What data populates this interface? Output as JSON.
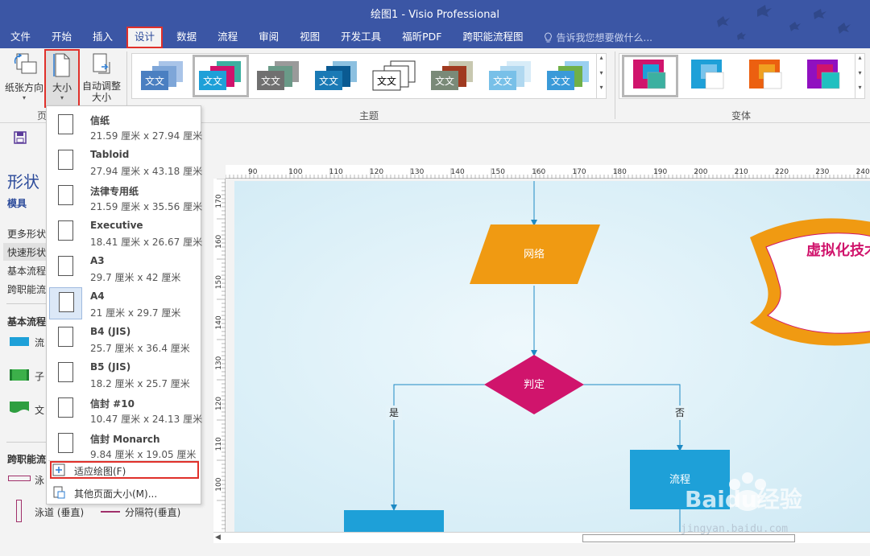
{
  "app": {
    "title": "绘图1 - Visio Professional"
  },
  "ribbon_tabs": [
    {
      "label": "文件",
      "active": false
    },
    {
      "label": "开始",
      "active": false
    },
    {
      "label": "插入",
      "active": false
    },
    {
      "label": "设计",
      "active": true
    },
    {
      "label": "数据",
      "active": false
    },
    {
      "label": "流程",
      "active": false
    },
    {
      "label": "审阅",
      "active": false
    },
    {
      "label": "视图",
      "active": false
    },
    {
      "label": "开发工具",
      "active": false
    },
    {
      "label": "福昕PDF",
      "active": false
    },
    {
      "label": "跨职能流程图",
      "active": false
    }
  ],
  "tell_me": {
    "placeholder": "告诉我您想要做什么..."
  },
  "page_setup": {
    "orientation_label": "纸张方向",
    "size_label": "大小",
    "autofit_label_1": "自动调整",
    "autofit_label_2": "大小",
    "group_label": "页"
  },
  "themes": {
    "group_label": "主题",
    "sample_text": "文文",
    "items": [
      {
        "name": "theme-1",
        "colors": [
          "#4a7fc1",
          "#7ea6d8",
          "#a9c4e8"
        ]
      },
      {
        "name": "theme-2",
        "colors": [
          "#1ea0d8",
          "#d0146c",
          "#3cb0a0"
        ],
        "selected": true
      },
      {
        "name": "theme-3",
        "colors": [
          "#707070",
          "#6a9a88",
          "#9a9a9a"
        ]
      },
      {
        "name": "theme-4",
        "colors": [
          "#1a7ab5",
          "#0a5a92",
          "#8cc0e0"
        ]
      },
      {
        "name": "theme-5",
        "colors": [
          "#ffffff",
          "#ffffff",
          "#ffffff"
        ]
      },
      {
        "name": "theme-6",
        "colors": [
          "#7a8a78",
          "#a03a20",
          "#c8c8b0"
        ]
      },
      {
        "name": "theme-7",
        "colors": [
          "#78c0e8",
          "#b0d8f0",
          "#d8ecf8"
        ]
      },
      {
        "name": "theme-8",
        "colors": [
          "#3a9ad8",
          "#70b048",
          "#9ad0f0"
        ]
      }
    ]
  },
  "variants": {
    "group_label": "变体",
    "items": [
      {
        "name": "variant-1",
        "colors": [
          "#d0146c",
          "#1ea0d8",
          "#3cb0a0"
        ],
        "selected": true
      },
      {
        "name": "variant-2",
        "colors": [
          "#1ea0d8",
          "#78c4ec",
          "#ffffff"
        ]
      },
      {
        "name": "variant-3",
        "colors": [
          "#ec6010",
          "#f0a020",
          "#ffffff"
        ]
      },
      {
        "name": "variant-4",
        "colors": [
          "#9010c0",
          "#d0146c",
          "#20c0c0"
        ]
      }
    ]
  },
  "shapes_panel": {
    "title": "形状",
    "tab_stencils": "模具",
    "more_shapes": "更多形状",
    "quick_shapes": "快速形状",
    "basic_flow": "基本流程",
    "cross_func": "跨职能流",
    "basic_flow_head": "基本流程",
    "shape_1": "流",
    "shape_2": "子",
    "shape_3": "文",
    "cross_func_head": "跨职能流",
    "swimlane_h": "泳",
    "swimlane_v": "泳道 (垂直)",
    "separator_v": "分隔符(垂直)"
  },
  "size_menu": {
    "items": [
      {
        "name": "信纸",
        "dims": "21.59 厘米 x 27.94 厘米",
        "orient": "portrait"
      },
      {
        "name": "Tabloid",
        "dims": "27.94 厘米 x 43.18 厘米",
        "orient": "portrait"
      },
      {
        "name": "法律专用纸",
        "dims": "21.59 厘米 x 35.56 厘米",
        "orient": "portrait"
      },
      {
        "name": "Executive",
        "dims": "18.41 厘米 x 26.67 厘米",
        "orient": "portrait"
      },
      {
        "name": "A3",
        "dims": "29.7 厘米 x 42 厘米",
        "orient": "portrait"
      },
      {
        "name": "A4",
        "dims": "21 厘米 x 29.7 厘米",
        "orient": "portrait",
        "selected": true
      },
      {
        "name": "B4 (JIS)",
        "dims": "25.7 厘米 x 36.4 厘米",
        "orient": "portrait"
      },
      {
        "name": "B5 (JIS)",
        "dims": "18.2 厘米 x 25.7 厘米",
        "orient": "portrait"
      },
      {
        "name": "信封 #10",
        "dims": "10.47 厘米 x 24.13 厘米",
        "orient": "portrait"
      },
      {
        "name": "信封 Monarch",
        "dims": "9.84 厘米 x 19.05 厘米",
        "orient": "portrait"
      }
    ],
    "fit_drawing": "适应绘图(F)",
    "other_sizes": "其他页面大小(M)..."
  },
  "ruler": {
    "h_labels": [
      "90",
      "100",
      "110",
      "120",
      "130",
      "140",
      "150",
      "160",
      "170",
      "180",
      "190",
      "200",
      "210",
      "220",
      "230",
      "240"
    ],
    "v_labels": [
      "170",
      "160",
      "150",
      "140",
      "130",
      "120",
      "110",
      "100"
    ]
  },
  "diagram": {
    "network": "网络",
    "decision": "判定",
    "yes": "是",
    "no": "否",
    "process": "流程",
    "virtualization": "虚拟化技术"
  },
  "watermark": {
    "brand": "Baidu经验",
    "url": "jingyan.baidu.com"
  },
  "colors": {
    "ribbon": "#3b56a5",
    "highlight": "#e0302a",
    "accent": "#2b4a9a"
  }
}
